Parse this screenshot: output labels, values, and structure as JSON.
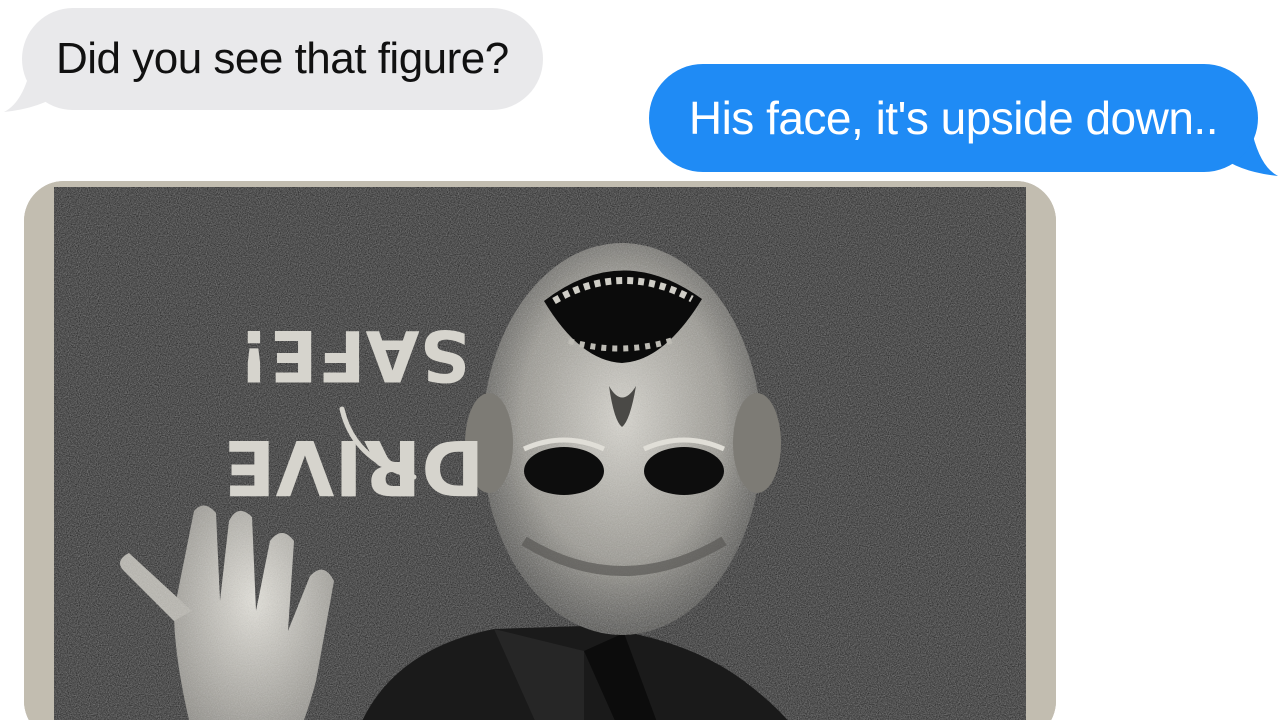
{
  "conversation": {
    "messages": [
      {
        "direction": "received",
        "type": "text",
        "text": "Did you see that figure?"
      },
      {
        "direction": "sent",
        "type": "text",
        "text": "His face, it's upside down.."
      },
      {
        "direction": "received",
        "type": "image",
        "image": {
          "handwritten_text": [
            "DRIVE",
            "SAFE!"
          ],
          "description_icon": "drawing-upside-down-figure-waving"
        }
      }
    ]
  },
  "colors": {
    "received_bubble": "#e9e9eb",
    "sent_bubble": "#1f8bf5",
    "photo_background": "#050505",
    "photo_border": "#c2bdb0"
  }
}
